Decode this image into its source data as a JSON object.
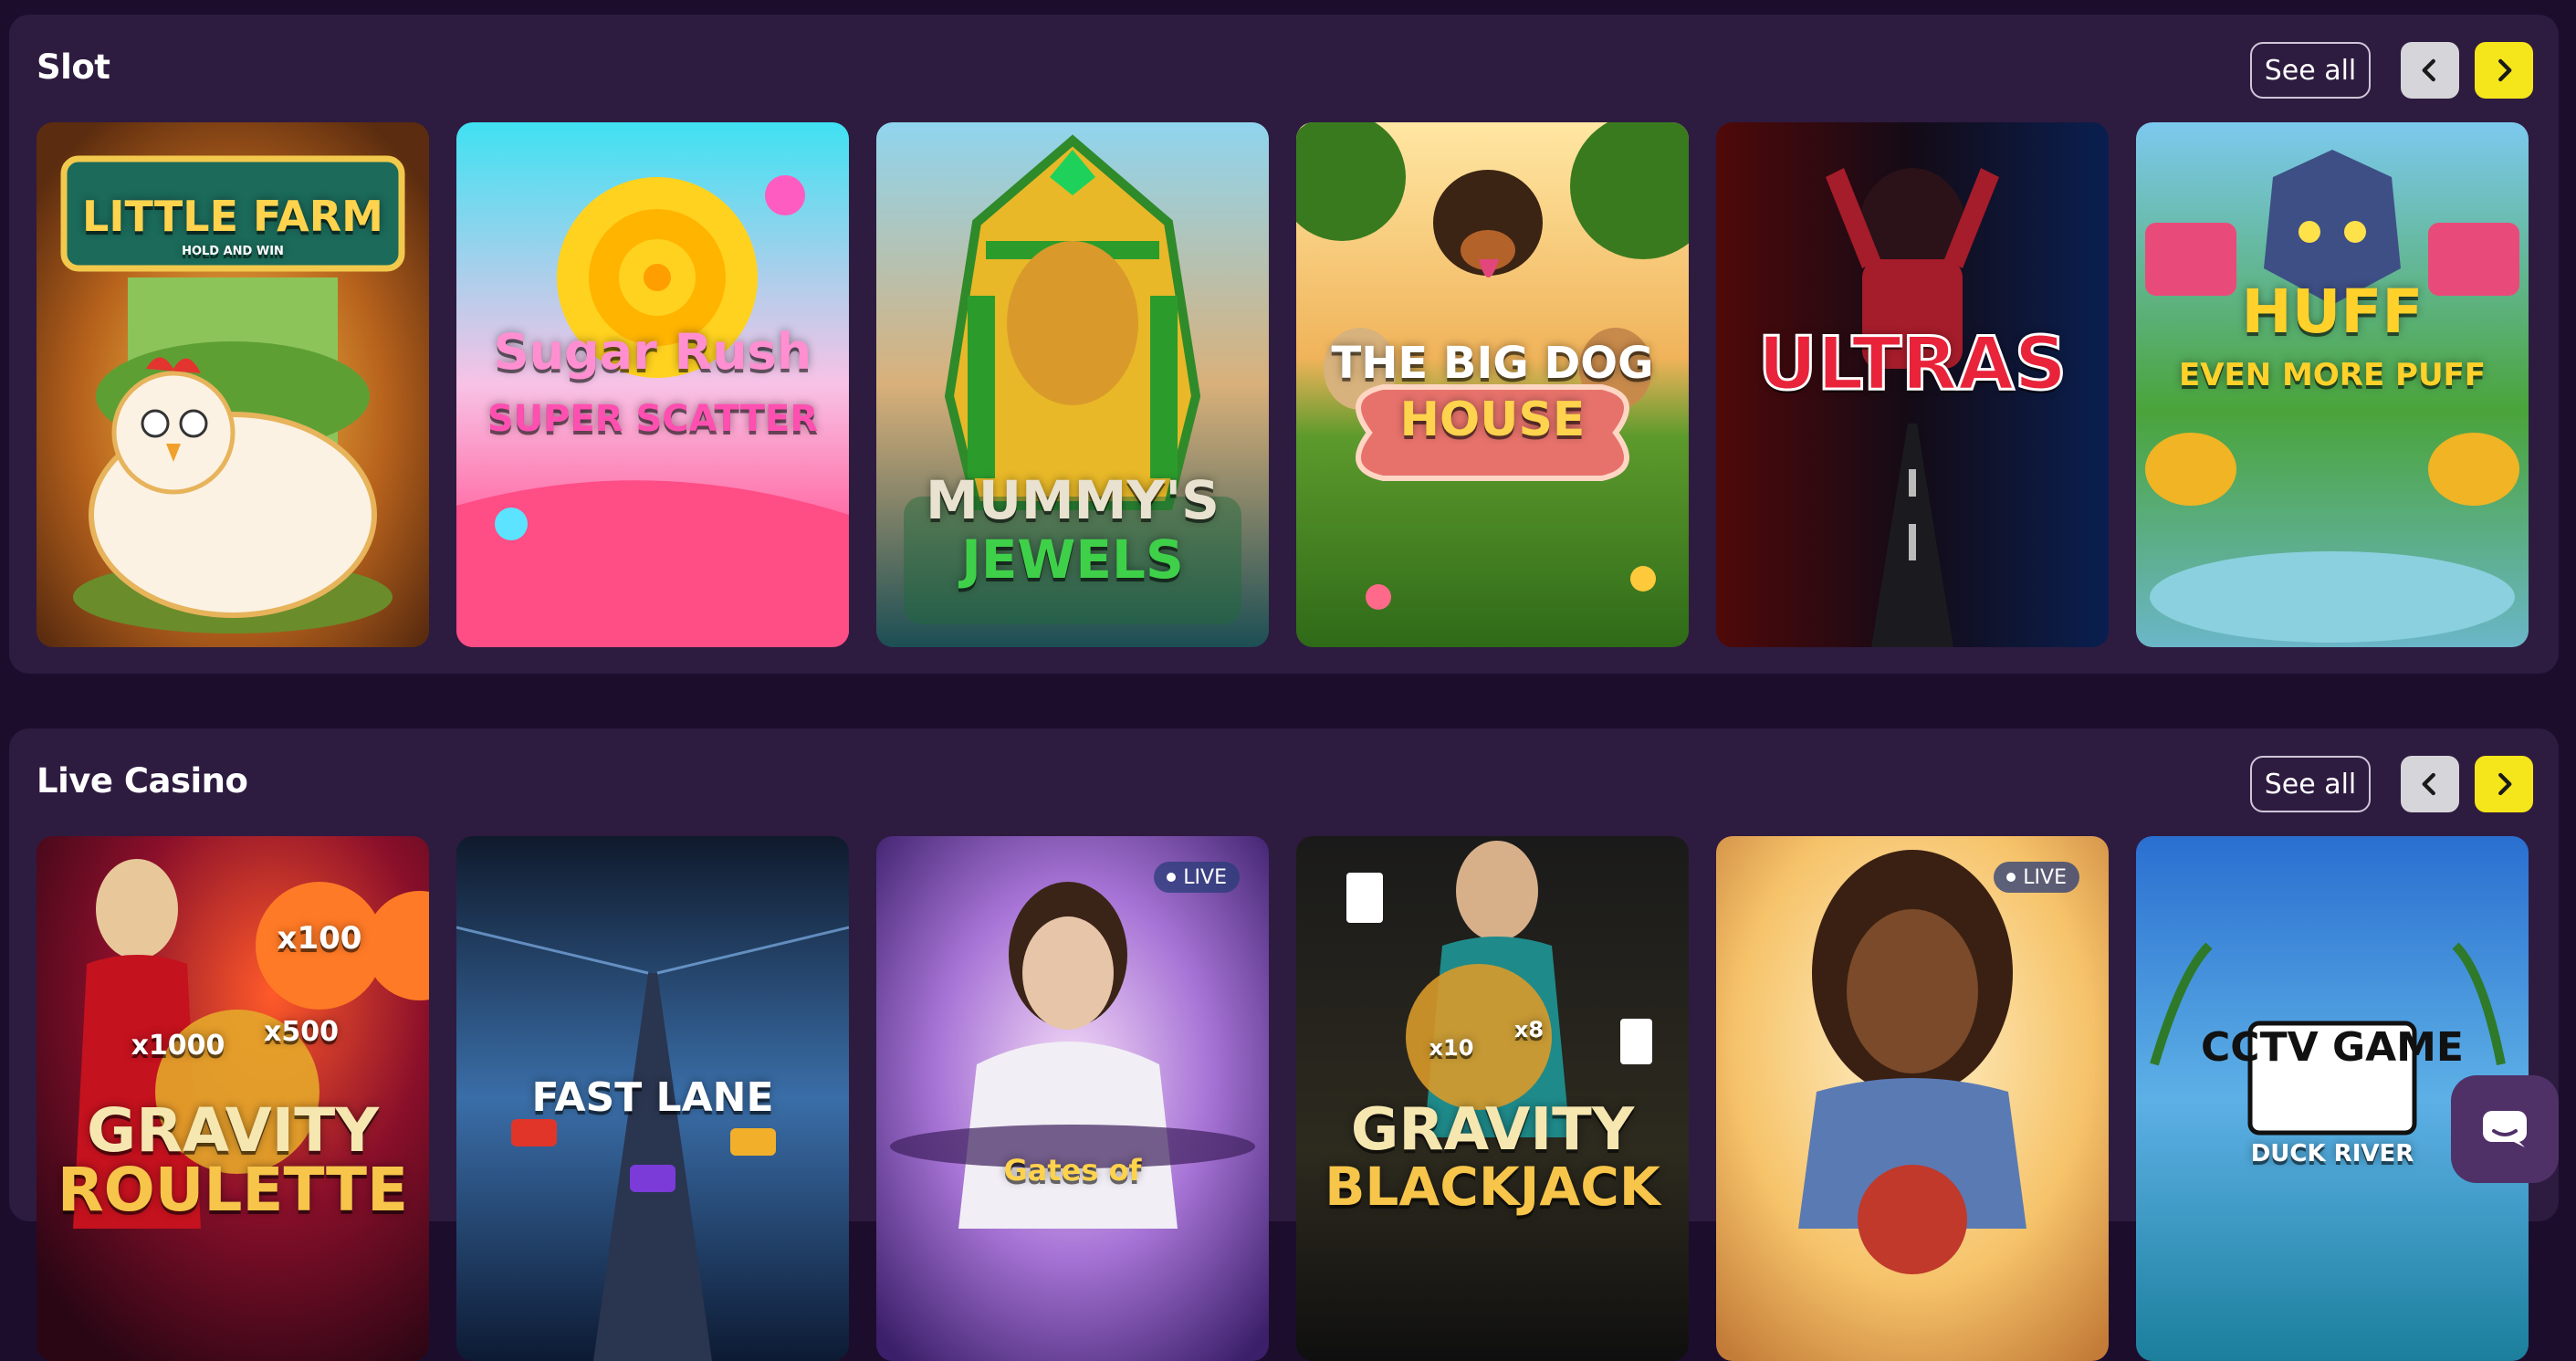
{
  "slot": {
    "title": "Slot",
    "see_all_label": "See all",
    "games": [
      {
        "title": "LITTLE FARM",
        "subtitle": "HOLD AND WIN"
      },
      {
        "title": "Sugar Rush",
        "subtitle": "SUPER SCATTER"
      },
      {
        "title": "MUMMY'S",
        "subtitle": "JEWELS"
      },
      {
        "title": "THE BIG DOG",
        "subtitle": "HOUSE"
      },
      {
        "title": "ULTRAS",
        "subtitle": ""
      },
      {
        "title": "HUFF",
        "subtitle": "EVEN MORE PUFF"
      }
    ]
  },
  "live_casino": {
    "title": "Live Casino",
    "see_all_label": "See all",
    "live_badge_label": "LIVE",
    "games": [
      {
        "title": "GRAVITY",
        "subtitle": "ROULETTE",
        "multipliers": [
          "x100",
          "x1000",
          "x500"
        ]
      },
      {
        "title": "FAST LANE",
        "subtitle": ""
      },
      {
        "title": "Gates of",
        "subtitle": ""
      },
      {
        "title": "GRAVITY",
        "subtitle": "BLACKJACK",
        "multipliers": [
          "x10",
          "x8"
        ]
      },
      {
        "title": "",
        "subtitle": ""
      },
      {
        "title": "CCTV GAME",
        "subtitle": "DUCK RIVER"
      }
    ]
  },
  "colors": {
    "page_bg": "#1d0d2c",
    "section_bg": "#2e1b40",
    "next_button": "#f5e51b",
    "prev_button": "#d6d5d9"
  },
  "icons": {
    "prev": "chevron-left-icon",
    "next": "chevron-right-icon",
    "chat": "chat-icon"
  }
}
